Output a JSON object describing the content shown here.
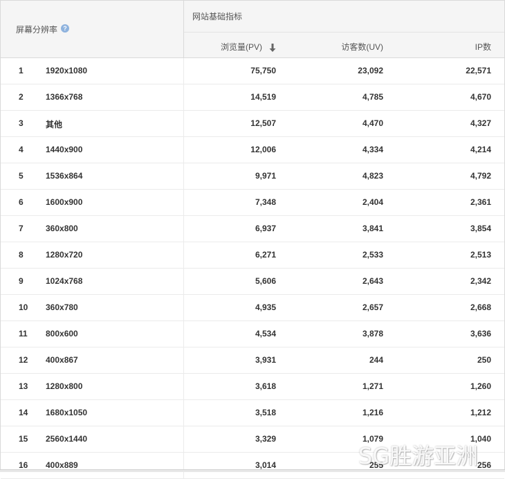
{
  "header": {
    "resolution_label": "屏幕分辨率",
    "help_icon": "help-icon",
    "group_label": "网站基础指标",
    "pv_label": "浏览量(PV)",
    "uv_label": "访客数(UV)",
    "ip_label": "IP数",
    "sort_icon": "arrow-down-icon"
  },
  "rows": [
    {
      "rank": "1",
      "resolution": "1920x1080",
      "pv": "75,750",
      "uv": "23,092",
      "ip": "22,571"
    },
    {
      "rank": "2",
      "resolution": "1366x768",
      "pv": "14,519",
      "uv": "4,785",
      "ip": "4,670"
    },
    {
      "rank": "3",
      "resolution": "其他",
      "pv": "12,507",
      "uv": "4,470",
      "ip": "4,327"
    },
    {
      "rank": "4",
      "resolution": "1440x900",
      "pv": "12,006",
      "uv": "4,334",
      "ip": "4,214"
    },
    {
      "rank": "5",
      "resolution": "1536x864",
      "pv": "9,971",
      "uv": "4,823",
      "ip": "4,792"
    },
    {
      "rank": "6",
      "resolution": "1600x900",
      "pv": "7,348",
      "uv": "2,404",
      "ip": "2,361"
    },
    {
      "rank": "7",
      "resolution": "360x800",
      "pv": "6,937",
      "uv": "3,841",
      "ip": "3,854"
    },
    {
      "rank": "8",
      "resolution": "1280x720",
      "pv": "6,271",
      "uv": "2,533",
      "ip": "2,513"
    },
    {
      "rank": "9",
      "resolution": "1024x768",
      "pv": "5,606",
      "uv": "2,643",
      "ip": "2,342"
    },
    {
      "rank": "10",
      "resolution": "360x780",
      "pv": "4,935",
      "uv": "2,657",
      "ip": "2,668"
    },
    {
      "rank": "11",
      "resolution": "800x600",
      "pv": "4,534",
      "uv": "3,878",
      "ip": "3,636"
    },
    {
      "rank": "12",
      "resolution": "400x867",
      "pv": "3,931",
      "uv": "244",
      "ip": "250"
    },
    {
      "rank": "13",
      "resolution": "1280x800",
      "pv": "3,618",
      "uv": "1,271",
      "ip": "1,260"
    },
    {
      "rank": "14",
      "resolution": "1680x1050",
      "pv": "3,518",
      "uv": "1,216",
      "ip": "1,212"
    },
    {
      "rank": "15",
      "resolution": "2560x1440",
      "pv": "3,329",
      "uv": "1,079",
      "ip": "1,040"
    },
    {
      "rank": "16",
      "resolution": "400x889",
      "pv": "3,014",
      "uv": "255",
      "ip": "256"
    }
  ],
  "watermark": "SG胜游亚洲"
}
